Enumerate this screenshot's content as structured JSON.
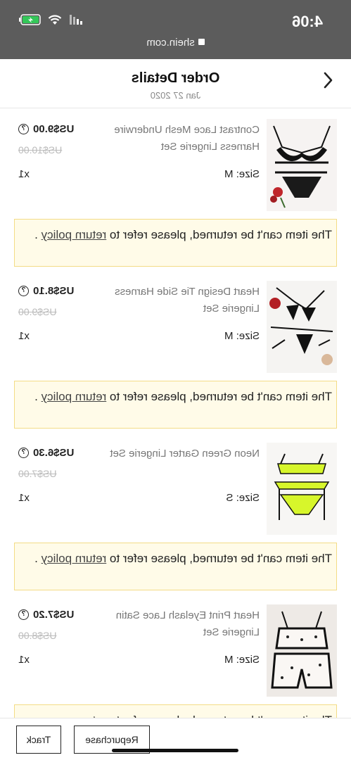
{
  "status_bar": {
    "time": "4:06",
    "url": "shein.com"
  },
  "header": {
    "title": "Order Details",
    "date": "Jan 27 2020"
  },
  "items": [
    {
      "name": "Contrast Lace Mesh Underwire Harness Lingerie Set",
      "size": "Size: M",
      "price": "US$9.00",
      "original_price": "US$10.00",
      "quantity": "x1",
      "notice_text": "The item can't be returned, please refer to ",
      "notice_link": "return policy",
      "notice_end": " ."
    },
    {
      "name": "Heart Design Tie Side Harness Lingerie Set",
      "size": "Size: M",
      "price": "US$8.10",
      "original_price": "US$9.00",
      "quantity": "x1",
      "notice_text": "The item can't be returned, please refer to ",
      "notice_link": "return policy",
      "notice_end": " ."
    },
    {
      "name": "Neon Green Garter Lingerie Set",
      "size": "Size: S",
      "price": "US$6.30",
      "original_price": "US$7.00",
      "quantity": "x1",
      "notice_text": "The item can't be returned, please refer to ",
      "notice_link": "return policy",
      "notice_end": " ."
    },
    {
      "name": "Heart Print Eyelash Lace Satin Lingerie Set",
      "size": "Size: M",
      "price": "US$7.20",
      "original_price": "US$8.00",
      "quantity": "x1",
      "notice_text": "The item can't be returned, please refer to ",
      "notice_link": "return",
      "notice_end": ""
    }
  ],
  "actions": {
    "track_label": "Track",
    "repurchase_label": "Repurchase"
  },
  "icons": {
    "back": "chevron-left-icon",
    "lock": "lock-icon",
    "price_help": "question-circle-icon",
    "battery": "battery-charging-icon",
    "wifi": "wifi-icon",
    "signal": "signal-icon"
  },
  "colors": {
    "status_bar_bg": "#5c5c5c",
    "notice_bg": "#fffbe8",
    "notice_border": "#f3dc86",
    "battery_green": "#34c759"
  }
}
